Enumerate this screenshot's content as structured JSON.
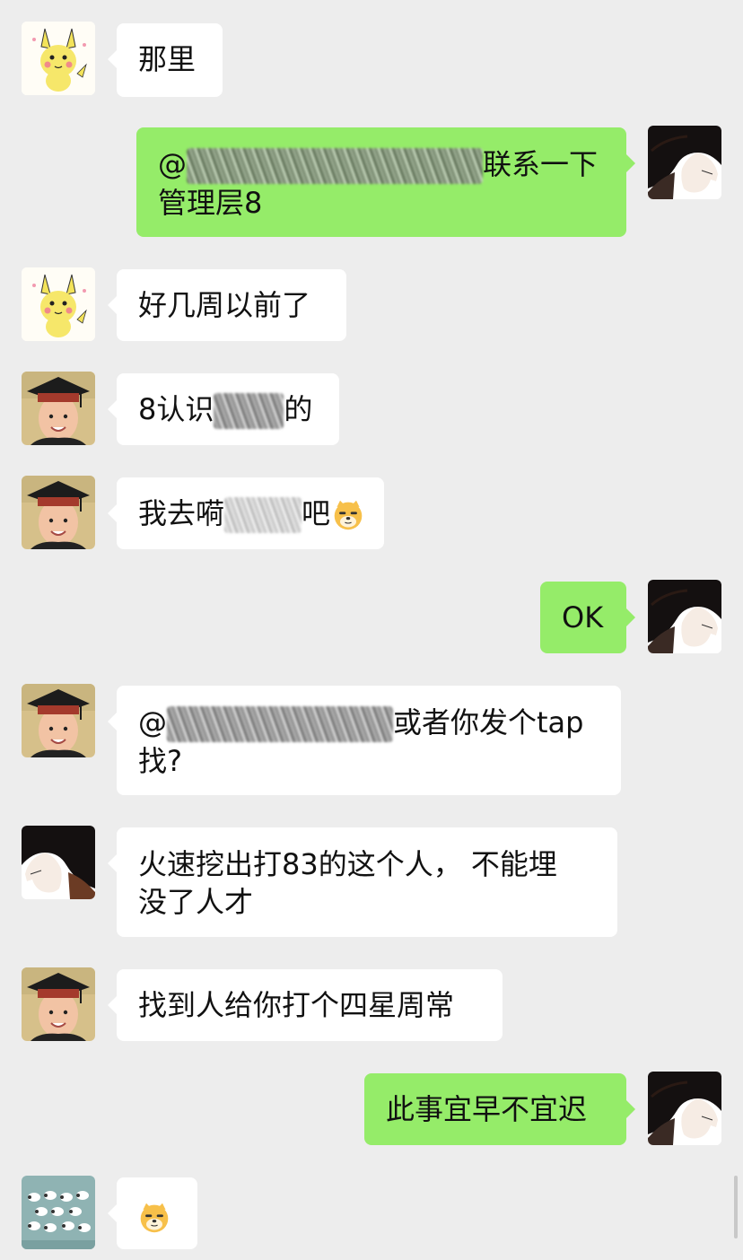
{
  "messages": [
    {
      "side": "in",
      "avatar": "pikachu-avatar",
      "text": "那里"
    },
    {
      "side": "out",
      "avatar": "dark-hair-avatar",
      "prefix": "@",
      "suffix": "联系一下",
      "line2": "管理层8",
      "redacted": true
    },
    {
      "side": "in",
      "avatar": "pikachu-avatar",
      "text": "好几周以前了"
    },
    {
      "side": "in",
      "avatar": "graduate-child-avatar",
      "prefix": "8认识",
      "suffix": "的",
      "redacted": true
    },
    {
      "side": "in",
      "avatar": "graduate-child-avatar",
      "prefix": "我去嗬",
      "suffix": "吧",
      "redacted": true,
      "emoji": "doge-emoji"
    },
    {
      "side": "out",
      "avatar": "dark-hair-avatar",
      "text": "OK"
    },
    {
      "side": "in",
      "avatar": "graduate-child-avatar",
      "prefix": "@",
      "suffix": "或者你发个tap",
      "line2": "找?",
      "redacted": true
    },
    {
      "side": "in",
      "avatar": "dark-hair-avatar",
      "text": "火速挖出打83的这个人， 不能埋",
      "line2": "没了人才"
    },
    {
      "side": "in",
      "avatar": "graduate-child-avatar",
      "text": "找到人给你打个四星周常"
    },
    {
      "side": "out",
      "avatar": "dark-hair-avatar",
      "text": "此事宜早不宜迟"
    },
    {
      "side": "in",
      "avatar": "sheep-pattern-avatar",
      "emoji": "doge-emoji"
    }
  ],
  "colors": {
    "background": "#ededed",
    "incoming_bubble": "#ffffff",
    "outgoing_bubble": "#95ec69"
  }
}
